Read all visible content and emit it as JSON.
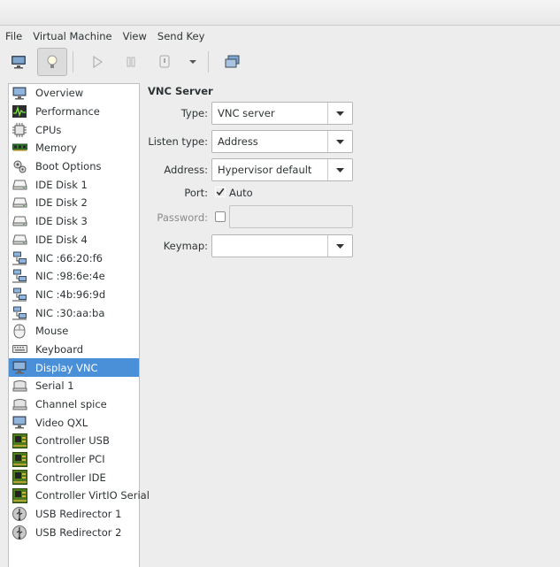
{
  "menu": [
    "File",
    "Virtual Machine",
    "View",
    "Send Key"
  ],
  "toolbar": {
    "console_icon": "monitor-icon",
    "details_icon": "lightbulb-icon",
    "run_icon": "play-icon",
    "pause_icon": "pause-icon",
    "shutdown_icon": "power-icon",
    "shutdown_menu_icon": "chevron-down-icon",
    "fullscreen_icon": "fullscreen-icon"
  },
  "sidebar": {
    "selected_index": 15,
    "items": [
      {
        "label": "Overview",
        "icon": "monitor-icon"
      },
      {
        "label": "Performance",
        "icon": "performance-icon"
      },
      {
        "label": "CPUs",
        "icon": "cpu-icon"
      },
      {
        "label": "Memory",
        "icon": "memory-icon"
      },
      {
        "label": "Boot Options",
        "icon": "gears-icon"
      },
      {
        "label": "IDE Disk 1",
        "icon": "disk-icon"
      },
      {
        "label": "IDE Disk 2",
        "icon": "disk-icon"
      },
      {
        "label": "IDE Disk 3",
        "icon": "disk-icon"
      },
      {
        "label": "IDE Disk 4",
        "icon": "disk-icon"
      },
      {
        "label": "NIC :66:20:f6",
        "icon": "network-icon"
      },
      {
        "label": "NIC :98:6e:4e",
        "icon": "network-icon"
      },
      {
        "label": "NIC :4b:96:9d",
        "icon": "network-icon"
      },
      {
        "label": "NIC :30:aa:ba",
        "icon": "network-icon"
      },
      {
        "label": "Mouse",
        "icon": "mouse-icon"
      },
      {
        "label": "Keyboard",
        "icon": "keyboard-icon"
      },
      {
        "label": "Display VNC",
        "icon": "monitor-icon"
      },
      {
        "label": "Serial 1",
        "icon": "serial-icon"
      },
      {
        "label": "Channel spice",
        "icon": "serial-icon"
      },
      {
        "label": "Video QXL",
        "icon": "monitor-icon"
      },
      {
        "label": "Controller USB",
        "icon": "controller-icon"
      },
      {
        "label": "Controller PCI",
        "icon": "controller-icon"
      },
      {
        "label": "Controller IDE",
        "icon": "controller-icon"
      },
      {
        "label": "Controller VirtIO Serial",
        "icon": "controller-icon"
      },
      {
        "label": "USB Redirector 1",
        "icon": "usb-icon"
      },
      {
        "label": "USB Redirector 2",
        "icon": "usb-icon"
      }
    ]
  },
  "vnc": {
    "title": "VNC Server",
    "type": {
      "label": "Type:",
      "value": "VNC server"
    },
    "listen_type": {
      "label": "Listen type:",
      "value": "Address"
    },
    "address": {
      "label": "Address:",
      "value": "Hypervisor default"
    },
    "port": {
      "label": "Port:",
      "auto_label": "Auto",
      "auto_checked": true
    },
    "password": {
      "label": "Password:",
      "checked": false,
      "value": ""
    },
    "keymap": {
      "label": "Keymap:",
      "value": ""
    }
  }
}
